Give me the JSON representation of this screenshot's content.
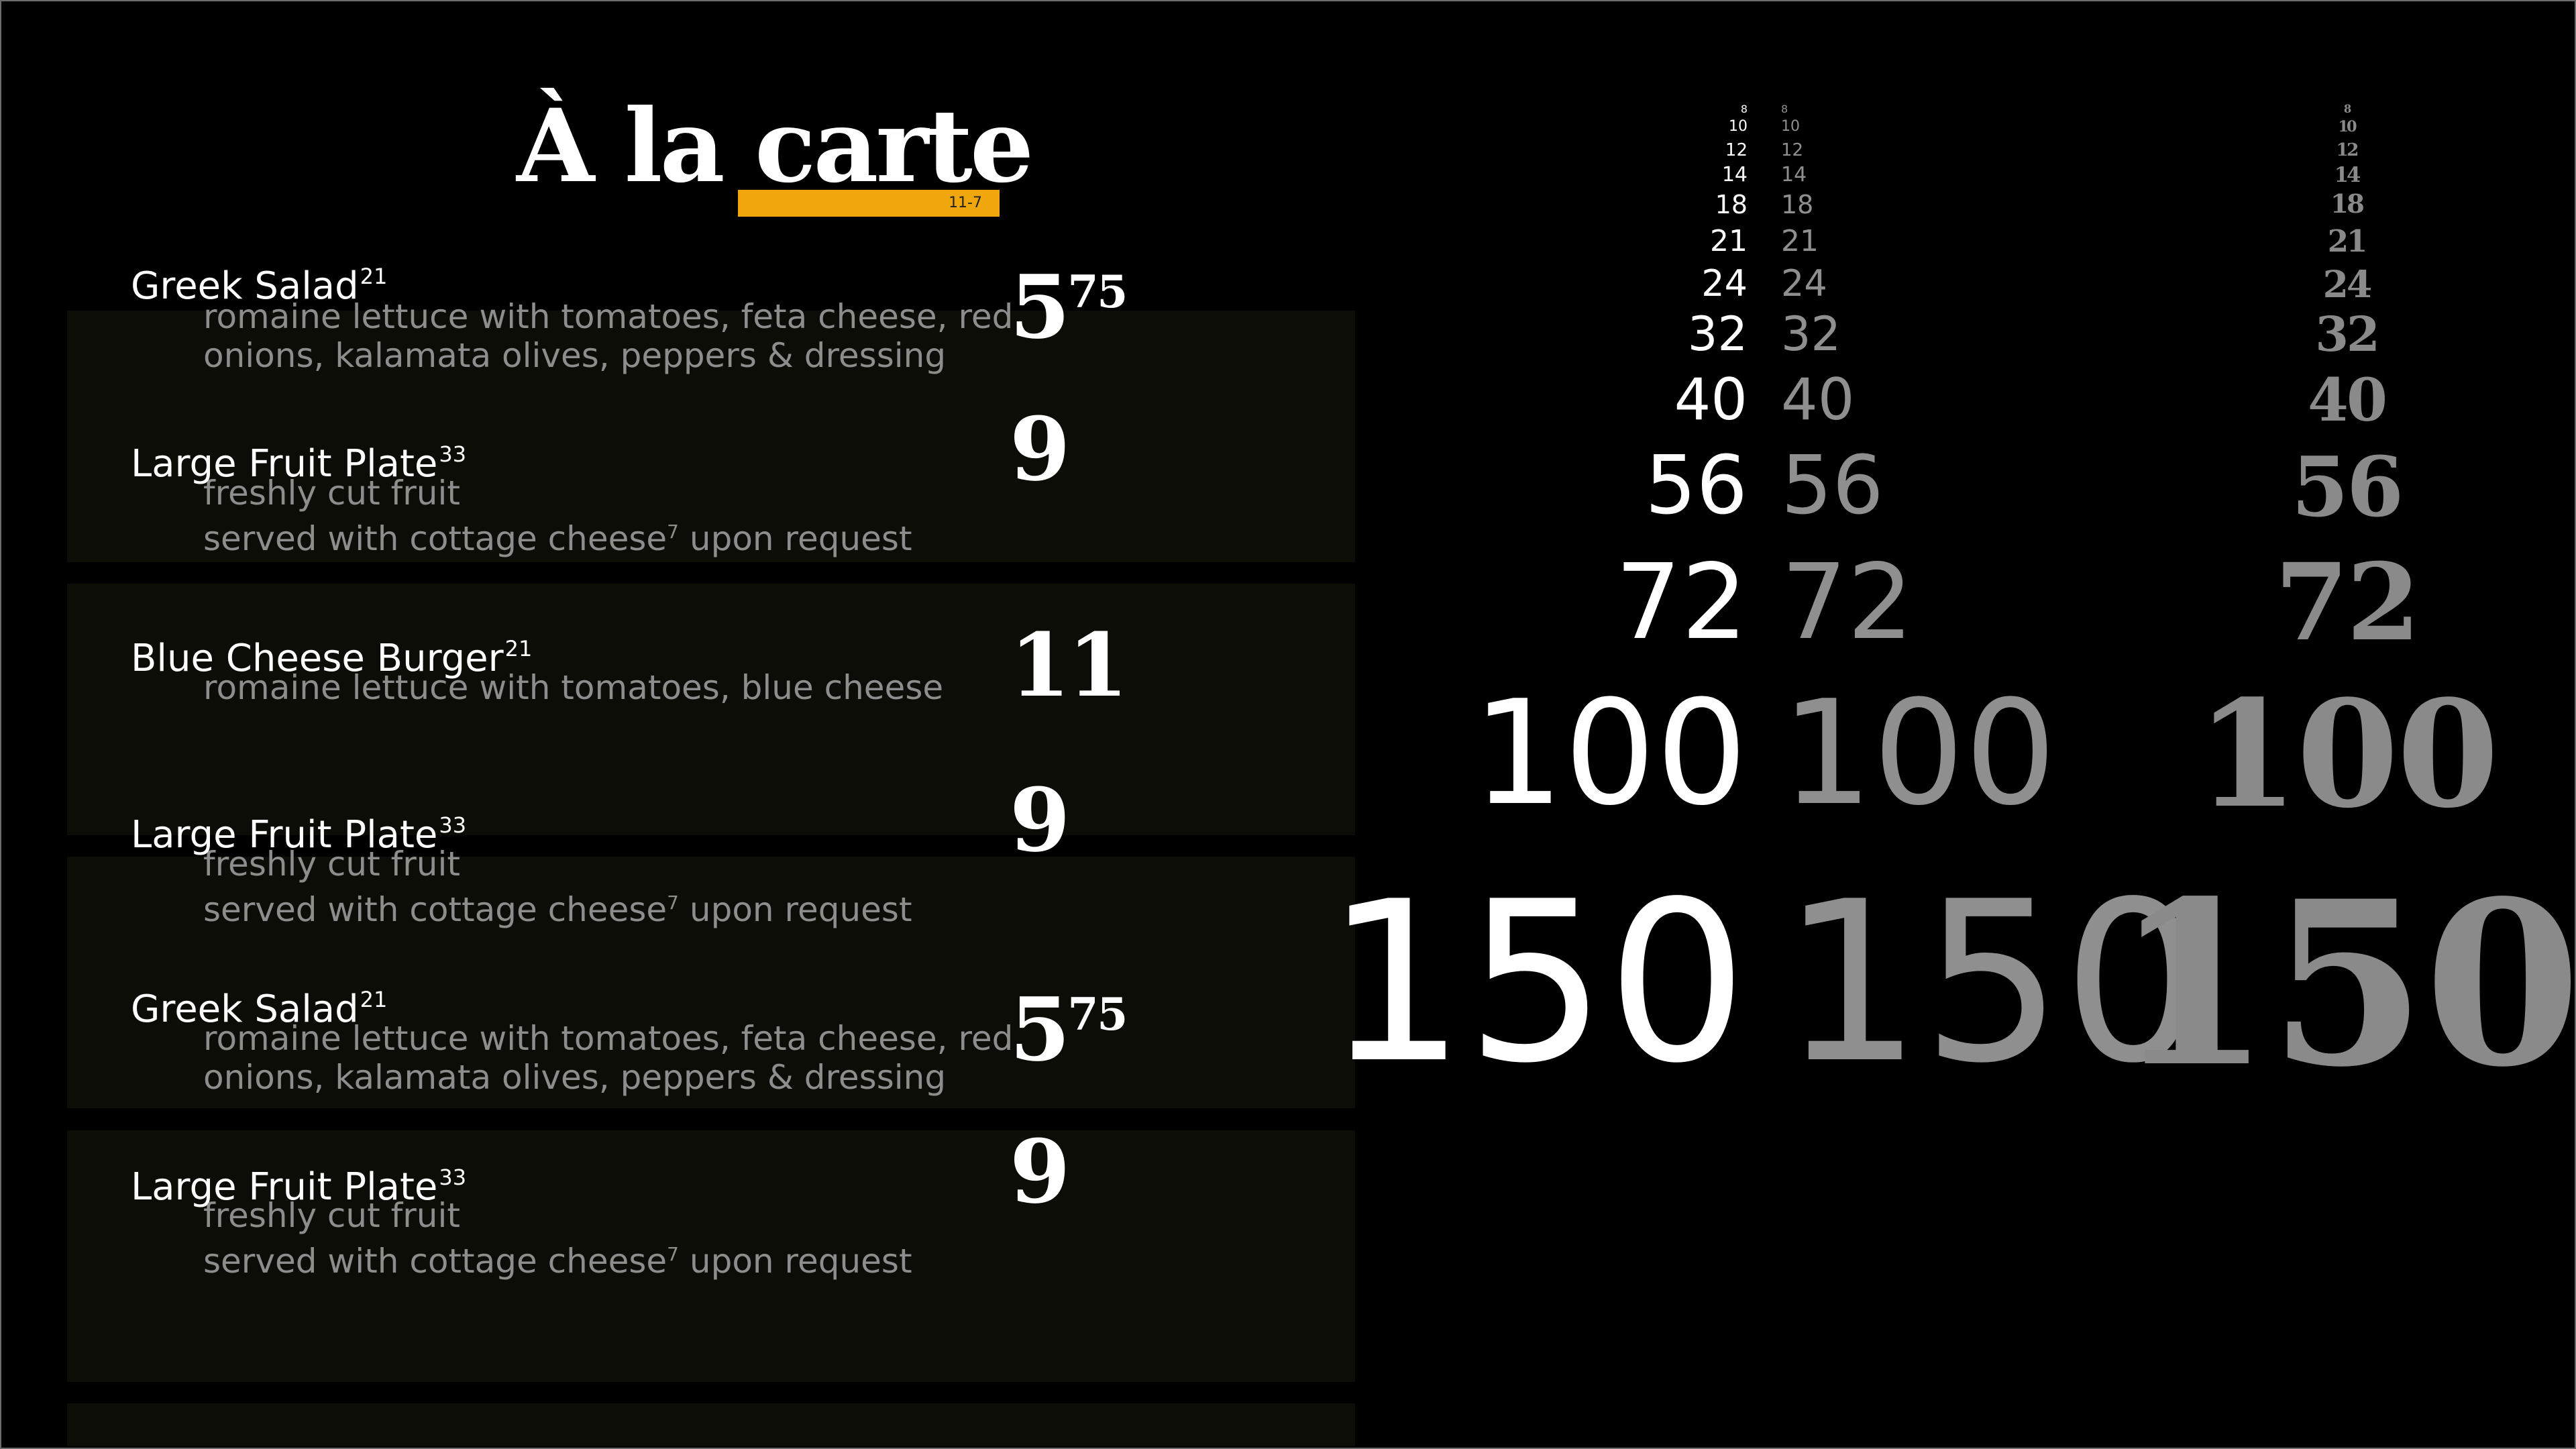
{
  "title": "À la carte",
  "tag_label": "11-7",
  "menu": [
    {
      "name": "Greek Salad",
      "sup": "21",
      "desc": [
        "romaine lettuce with tomatoes, feta cheese, red",
        "onions, kalamata olives, peppers & dressing"
      ],
      "price": "5",
      "price_sup": "75"
    },
    {
      "name": "Large Fruit Plate",
      "sup": "33",
      "desc": [
        "freshly cut fruit",
        "served with cottage cheese",
        "upon request"
      ],
      "price": "9",
      "price_sup": ""
    },
    {
      "name": "Blue Cheese Burger",
      "sup": "21",
      "desc": [
        "romaine lettuce with tomatoes, blue cheese"
      ],
      "price": "11",
      "price_sup": ""
    },
    {
      "name": "Large Fruit Plate",
      "sup": "33",
      "desc": [
        "freshly cut fruit",
        "served with cottage cheese",
        "upon request"
      ],
      "price": "9",
      "price_sup": ""
    },
    {
      "name": "Greek Salad",
      "sup": "21",
      "desc": [
        "romaine lettuce with tomatoes, feta cheese, red",
        "onions, kalamata olives, peppers & dressing"
      ],
      "price": "5",
      "price_sup": "75"
    },
    {
      "name": "Large Fruit Plate",
      "sup": "33",
      "desc": [
        "freshly cut fruit",
        "served with cottage cheese",
        "upon request"
      ],
      "price": "9",
      "price_sup": ""
    }
  ],
  "cottage_sup": "7",
  "type_scale": [
    "8",
    "10",
    "12",
    "14",
    "18",
    "21",
    "24",
    "32",
    "40",
    "56",
    "72",
    "100",
    "150"
  ],
  "colors": {
    "accent": "#f0a70d",
    "panel": "#0b0d06",
    "muted": "#8d8d8d",
    "scale_gray": "#8a8a8a"
  }
}
